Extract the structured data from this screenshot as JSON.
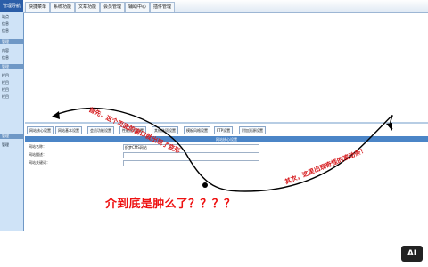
{
  "sidebar": {
    "title": "管理导航",
    "items": [
      "站点",
      "信息",
      "信息",
      "管理",
      "内容",
      "信息",
      "管理",
      "栏目",
      "栏目",
      "栏目",
      "栏目",
      "管理",
      "管理"
    ]
  },
  "topbar": {
    "tabs": [
      "快捷菜单",
      "系统功能",
      "文章功能",
      "会员管理",
      "辅助中心",
      "插件管理"
    ]
  },
  "menu": {
    "buttons": [
      "网站核心设置",
      "网站基本设置",
      "会员功能设置",
      "性能选项设置",
      "其他选项设置",
      "模板风格设置",
      "FTP设置",
      "附加资源设置"
    ]
  },
  "section": {
    "title": "网站核心设置"
  },
  "form": [
    {
      "label": "网站名称：",
      "value": "织梦CMS网站"
    },
    {
      "label": "网站描述：",
      "value": ""
    },
    {
      "label": "网站关键词：",
      "value": ""
    }
  ],
  "annotations": {
    "first": "首先，这个页面的窗口就出现了变形",
    "second": "其次，这里出现奇怪的滚动条！",
    "caption": "介到底是肿么了？？？？"
  },
  "logo": {
    "text": "AI"
  }
}
